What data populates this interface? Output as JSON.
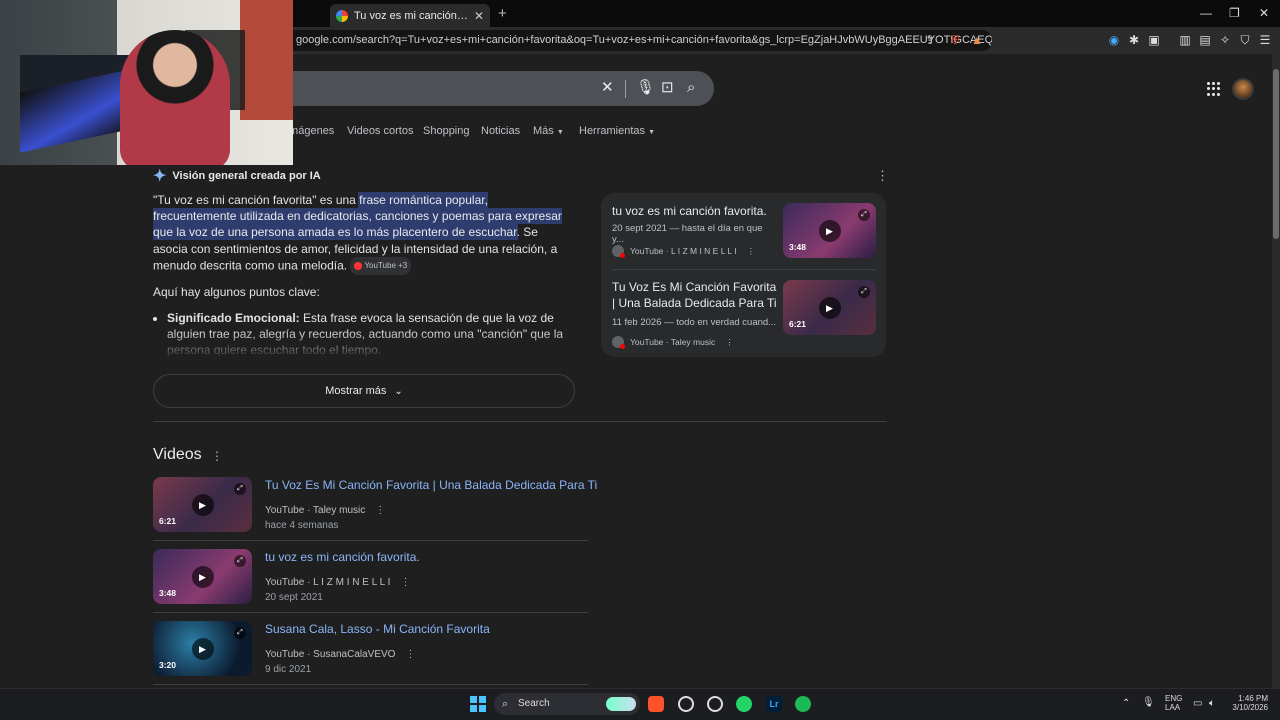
{
  "browser": {
    "tab_title": "Tu voz es mi canción favorita - B",
    "url": "google.com/search?q=Tu+voz+es+mi+canción+favorita&oq=Tu+voz+es+mi+canción+favorita&gs_lcrp=EgZjaHJvbWUyBggAEEUYOTIGCAEQLhhA..."
  },
  "google": {
    "tabs": [
      "Imágenes",
      "Videos cortos",
      "Shopping",
      "Noticias",
      "Más",
      "Herramientas"
    ]
  },
  "ai_overview": {
    "heading": "Visión general creada por IA",
    "intro_plain": "\"Tu voz es mi canción favorita\" es una ",
    "intro_highlight": "frase romántica popular, frecuentemente utilizada en dedicatorias, canciones y poemas para expresar que la voz de una persona amada es lo más placentero de escuchar",
    "intro_rest": ". Se asocia con sentimientos de amor, felicidad y la intensidad de una relación, a menudo descrita como una melodía.",
    "chip": "YouTube +3",
    "key_points_heading": "Aquí hay algunos puntos clave:",
    "bullet_title": "Significado Emocional:",
    "bullet_text": " Esta frase evoca la sensación de que la voz de alguien trae paz, alegría y recuerdos, actuando como una \"canción\" que la persona quiere escuchar todo el tiempo.",
    "show_more": "Mostrar más"
  },
  "source_cards": [
    {
      "title": "tu voz es mi canción favorita.",
      "snippet": "20 sept 2021 — hasta el día en que y...",
      "source": "YouTube · L I Z M I N E L L I",
      "duration": "3:48"
    },
    {
      "title": "Tu Voz Es Mi Canción Favorita | Una Balada Dedicada Para Ti",
      "snippet": "11 feb 2026 — todo en verdad cuand...",
      "source": "YouTube · Taley music",
      "duration": "6:21"
    }
  ],
  "videos": {
    "heading": "Videos",
    "items": [
      {
        "title": "Tu Voz Es Mi Canción Favorita | Una Balada Dedicada Para Ti",
        "source": "YouTube · Taley music",
        "date": "hace 4 semanas",
        "duration": "6:21"
      },
      {
        "title": "tu voz es mi canción favorita.",
        "source": "YouTube · L I Z M I N E L L I",
        "date": "20 sept 2021",
        "duration": "3:48"
      },
      {
        "title": "Susana Cala, Lasso - Mi Canción Favorita",
        "source": "YouTube · SusanaCalaVEVO",
        "date": "9 dic 2021",
        "duration": "3:20"
      }
    ]
  },
  "taskbar": {
    "search_label": "Search",
    "lang1": "ENG",
    "lang2": "LAA",
    "time": "1:46 PM",
    "date": "3/10/2026"
  },
  "icons": [
    "google-favicon",
    "close-icon",
    "mic-icon",
    "lens-icon",
    "search-icon",
    "apps-grid-icon",
    "ai-sparkle-icon",
    "play-icon",
    "expand-icon",
    "more-vert-icon",
    "chevron-down-icon",
    "windows-start-icon",
    "brave-icon",
    "chatgpt-icon",
    "whatsapp-icon",
    "lightroom-icon",
    "spotify-icon"
  ],
  "colors": {
    "background": "#1f1f1f",
    "link": "#8ab4f8",
    "highlight": "#2f3c6e"
  }
}
